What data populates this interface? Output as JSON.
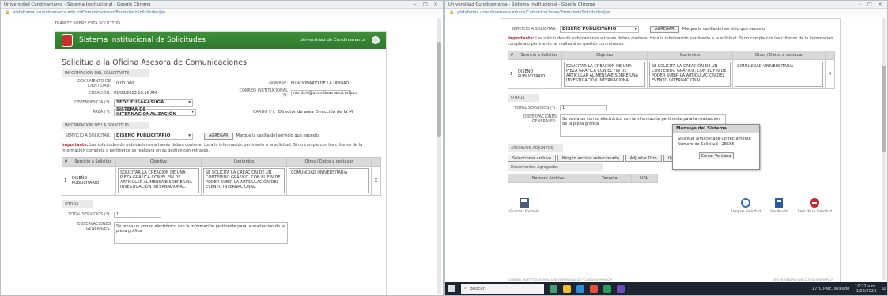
{
  "left": {
    "title": "Universidad Cundinamarca - Sistema Institucional - Google Chrome",
    "url": "plataforma.ucundinamarca.edu.co/Comunicaciones/FormularioSolicitudes/jsp",
    "topline": "TRAMITE SOBRE ESTA SOLICITUD",
    "system_name": "Sistema Institucional de Solicitudes",
    "university": "Universidad de Cundinamarca",
    "heading": "Solicitud a la Oficina Asesora de Comunicaciones",
    "section_personal": "INFORMACIÓN DEL SOLICITANTE",
    "doc_label": "DOCUMENTO DE IDENTIDAD:",
    "doc_value": "10 00 000",
    "name_label": "NOMBRE:",
    "name_value": "FUNCIONARIO DE LA UNIDAD",
    "creation_label": "CREACIÓN:",
    "creation_value": "01/03/2023 10:16 AM",
    "email_label": "CORREO INSTITUCIONAL (*):",
    "email_value": "nombre@ucundinamarca.edu.co",
    "dependency_label": "DEPENDENCIA (*):",
    "dependency_value": "SEDE FUSAGASUGÁ",
    "area_label": "ÁREA (*):",
    "area_value": "SISTEMA DE INTERNACIONALIZACIÓN",
    "cargo_label": "CARGO (*):",
    "cargo_value": "Director de area Dirección de la Mi",
    "section_request": "INFORMACIÓN DE LA SOLICITUD",
    "service_label": "SERVICIO A SOLICITAR:",
    "service_value": "DISEÑO PUBLICITARIO",
    "add_button": "AGREGAR",
    "service_hint": "Marque la casilla del servicio que necesita",
    "important_label": "Importante:",
    "important_text": "Las solicitudes de publicaciones a través deben contener toda la información pertinente a la solicitud. Si no cumple con los criterios de la información completa o pertinente se realizará en su gestión con retrasos.",
    "table_headers": [
      "#",
      "Servicio a Solicitar",
      "Objetivo",
      "Contenido",
      "Otros / Datos a destacar"
    ],
    "row": {
      "num": "1",
      "service": "DISEÑO PUBLICITARIO",
      "objective": "SOLICITAR LA CREACIÓN DE UNA PIEZA GRÁFICA CON EL FIN DE ARTICULAR AL MENSAJE SOBRE UNA INVESTIGACIÓN INTERNACIONAL.",
      "content": "SE SOLICITA LA CREACIÓN DE UN CONTENIDO GRÁFICO, CON EL FIN DE PODER SUBIR LA ARTICULACIÓN DEL EVENTO INTERNACIONAL.",
      "others": "COMUNIDAD UNIVERSITARIA",
      "action": "X"
    },
    "section_other": "OTROS",
    "total_label": "TOTAL SERVICIOS (*):",
    "total_value": "1",
    "observations_label": "OBSERVACIONES GENERALES:",
    "observations_value": "Se envía un correo electrónico con la información pertinente para la realización de la pieza gráfica."
  },
  "right": {
    "title": "Universidad Cundinamarca - Sistema Institucional - Google Chrome",
    "url": "plataforma.ucundinamarca.edu.co/Comunicaciones/FormularioSolicitudes/jsp",
    "service_label": "SERVICIO A SOLICITAR:",
    "service_value": "DISEÑO PUBLICITARIO",
    "add_button": "AGREGAR",
    "service_hint": "Marque la casilla del servicio que necesita",
    "important_label": "Importante:",
    "important_text": "Las solicitudes de publicaciones a través deben contener toda la información pertinente a la solicitud. Si no cumple con los criterios de la información completa o pertinente se realizará su gestión con retrasos.",
    "table_headers": [
      "#",
      "Servicio a Solicitar",
      "Objetivo",
      "Contenido",
      "Otros / Datos a destacar"
    ],
    "row": {
      "num": "1",
      "service": "DISEÑO PUBLICITARIO",
      "objective": "SOLICITAR LA CREACIÓN DE UNA PIEZA GRÁFICA CON EL FIN DE ARTICULAR AL MENSAJE SOBRE UNA INVESTIGACIÓN INTERNACIONAL.",
      "content": "SE SOLICITA LA CREACIÓN DE UN CONTENIDO GRÁFICO, CON EL FIN DE PODER SUBIR LA ARTICULACIÓN DEL EVENTO INTERNACIONAL.",
      "others": "COMUNIDAD UNIVERSITARIA",
      "action": "X"
    },
    "section_other": "OTROS",
    "total_label": "TOTAL SERVICIOS (*):",
    "total_value": "1",
    "observations_label": "OBSERVACIONES GENERALES:",
    "observations_value": "Se envía un correo electrónico con la información pertinente para la realización de la pieza gráfica.",
    "section_attachments": "ARCHIVOS ADJUNTOS",
    "tabs": [
      "Seleccionar archivo",
      "Ningún archivo seleccionado",
      "Adjuntar Otro",
      "Quitar archivo"
    ],
    "attached_label": "Documentos Agregados",
    "attached_headers": [
      "Nombre Archivo",
      "Tamaño",
      "URL"
    ],
    "footer_actions": [
      "Guardar Formato",
      "Limpiar Solicitud",
      "Ver Ayuda",
      "Salir de la Solicitud"
    ],
    "footer_note": "DISEÑO INSTITUCIONAL UNIVERSIDAD DE CUNDINAMARCA",
    "footer_right": "UNIVERSIDAD DE CUNDINAMARCA"
  },
  "modal": {
    "title": "Mensaje del Sistema",
    "line1": "Solicitud almacenada Correctamente",
    "line2": "Numero de Solicitud : 28585",
    "button": "Cerrar Ventana"
  },
  "taskbar": {
    "search": "Buscar",
    "weather": "17°C Parc. soleado",
    "time": "10:22 a.m.",
    "date": "1/03/2023"
  },
  "colors": {
    "banner": "#2f7a2c",
    "important": "#c0282d",
    "taskbar": "#1c2530"
  }
}
